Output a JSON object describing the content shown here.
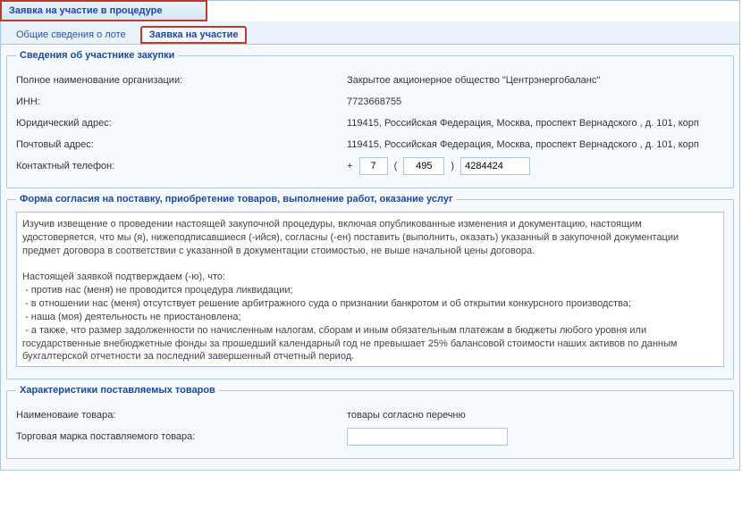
{
  "panel": {
    "title": "Заявка на участие в процедуре"
  },
  "tabs": {
    "general": "Общие сведения о лоте",
    "application": "Заявка на участие"
  },
  "participant": {
    "legend": "Сведения об участнике закупки",
    "full_name_label": "Полное наименование организации:",
    "full_name_value": "Закрытое акционерное общество \"Центрэнергобаланс\"",
    "inn_label": "ИНН:",
    "inn_value": "7723668755",
    "legal_addr_label": "Юридический адрес:",
    "legal_addr_value": "119415, Российская Федерация, Москва, проспект Вернадского , д. 101, корп",
    "postal_addr_label": "Почтовый адрес:",
    "postal_addr_value": "119415, Российская Федерация, Москва, проспект Вернадского , д. 101, корп",
    "phone_label": "Контактный телефон:",
    "phone_country": "7",
    "phone_area": "495",
    "phone_number": "4284424"
  },
  "consent": {
    "legend": "Форма согласия на поставку, приобретение товаров, выполнение работ, оказание услуг",
    "text": "Изучив извещение о проведении настоящей закупочной процедуры, включая опубликованные изменения и документацию, настоящим удостоверяется, что мы (я), нижеподписавшиеся (-ийся), согласны (-ен) поставить (выполнить, оказать) указанный в закупочной документации предмет договора в соответствии с указанной в документации стоимостью, не выше начальной цены договора.\n\nНастоящей заявкой подтверждаем (-ю), что:\n - против нас (меня) не проводится процедура ликвидации;\n - в отношении нас (меня) отсутствует решение арбитражного суда о признании банкротом и об открытии конкурсного производства;\n - наша (моя) деятельность не приостановлена;\n - а также, что размер задолженности по начисленным налогам, сборам и иным обязательным платежам в бюджеты любого уровня или государственные внебюджетные фонды за прошедший календарный год не превышает 25% балансовой стоимости наших активов по данным бухгалтерской отчетности за последний завершенный отчетный период."
  },
  "goods": {
    "legend": "Характеристики поставляемых товаров",
    "name_label": "Наименоваие товара:",
    "name_value": "товары согласно перечню",
    "brand_label": "Торговая марка поставляемого товара:",
    "brand_value": ""
  }
}
